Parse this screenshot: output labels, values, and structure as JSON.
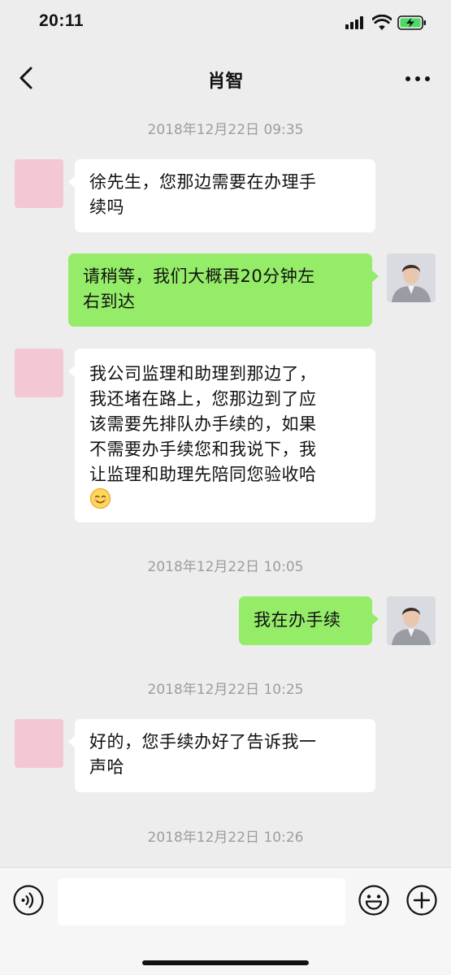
{
  "status_bar": {
    "time": "20:11",
    "battery_charging": true
  },
  "nav": {
    "title": "肖智",
    "back_icon": "chevron-left-icon",
    "more_icon": "more-dots-icon"
  },
  "chat": {
    "timestamps": [
      "2018年12月22日 09:35",
      "2018年12月22日 10:05",
      "2018年12月22日 10:25",
      "2018年12月22日 10:26"
    ],
    "messages": [
      {
        "from": "contact",
        "text": "徐先生，您那边需要在办理手\n续吗"
      },
      {
        "from": "me",
        "text": "请稍等，我们大概再20分钟左\n右到达"
      },
      {
        "from": "contact",
        "text": "我公司监理和助理到那边了，\n我还堵在路上，您那边到了应\n该需要先排队办手续的，如果\n不需要办手续您和我说下，我\n让监理和助理先陪同您验收哈",
        "emoji": "smile-emoji"
      },
      {
        "from": "me",
        "text": "我在办手续"
      },
      {
        "from": "contact",
        "text": "好的，您手续办好了告诉我一\n声哈"
      }
    ]
  },
  "input_bar": {
    "placeholder": "",
    "voice_icon": "voice-icon",
    "emoji_icon": "emoji-icon",
    "plus_icon": "plus-icon"
  },
  "colors": {
    "background": "#ededed",
    "outgoing_bubble": "#95ec69",
    "incoming_bubble": "#ffffff",
    "contact_avatar": "#f3c7d3",
    "timestamp_text": "#9d9d9d"
  }
}
